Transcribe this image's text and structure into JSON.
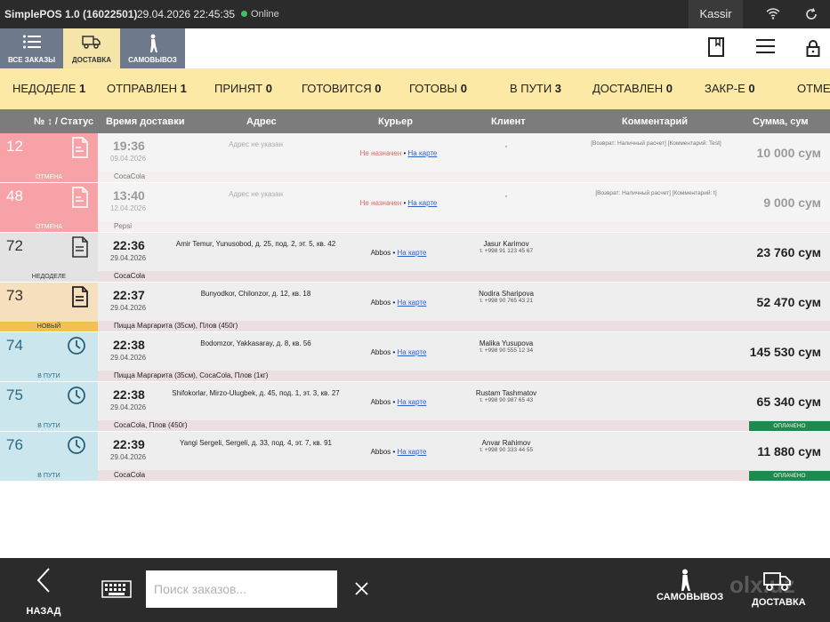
{
  "topbar": {
    "app_title": "SimplePOS 1.0 (16022501)",
    "datetime": "29.04.2026 22:45:35",
    "online": "Online",
    "user": "Kassir"
  },
  "tabs": [
    {
      "label": "ВСЕ ЗАКАЗЫ"
    },
    {
      "label": "ДОСТАВКА"
    },
    {
      "label": "САМОВЫВОЗ"
    }
  ],
  "status_filters": [
    {
      "label": "НЕДОДЕЛЕ",
      "count": "1"
    },
    {
      "label": "ОТПРАВЛЕН",
      "count": "1"
    },
    {
      "label": "ПРИНЯТ",
      "count": "0"
    },
    {
      "label": "ГОТОВИТСЯ",
      "count": "0"
    },
    {
      "label": "ГОТОВЫ",
      "count": "0"
    },
    {
      "label": "В ПУТИ",
      "count": "3"
    },
    {
      "label": "ДОСТАВЛЕН",
      "count": "0"
    },
    {
      "label": "ЗАКР-Е",
      "count": "0"
    },
    {
      "label": "ОТМЕ",
      "count": ""
    }
  ],
  "columns": [
    "№ ↕ / Статус",
    "Время доставки",
    "Адрес",
    "Курьер",
    "Клиент",
    "Комментарий",
    "Сумма, сум"
  ],
  "orders": [
    {
      "num": "12",
      "status": "ОТМЕНА",
      "time": "19:36",
      "date": "09.04.2026",
      "address": "Адрес не указан",
      "courier": "Не назначен",
      "map": "На карте",
      "client": "",
      "phone": "",
      "comment": "[Возврат: Наличный расчет] [Комментарий: Test]",
      "items": "CocaCola",
      "sum": "10 000 сум",
      "paid": ""
    },
    {
      "num": "48",
      "status": "ОТМЕНА",
      "time": "13:40",
      "date": "12.04.2026",
      "address": "Адрес не указан",
      "courier": "Не назначен",
      "map": "На карте",
      "client": "",
      "phone": "",
      "comment": "[Возврат: Наличный расчет] [Комментарий: t]",
      "items": "Pepsi",
      "sum": "9 000 сум",
      "paid": ""
    },
    {
      "num": "72",
      "status": "НЕДОДЕЛЕ",
      "time": "22:36",
      "date": "29.04.2026",
      "address": "Amir Temur, Yunusobod, д. 25, под. 2, эт. 5, кв. 42",
      "courier": "Abbos",
      "map": "На карте",
      "client": "Jasur Karimov",
      "phone": "т. +998 91 123 45 67",
      "comment": "",
      "items": "CocaCola",
      "sum": "23 760 сум",
      "paid": ""
    },
    {
      "num": "73",
      "status": "НОВЫЙ",
      "time": "22:37",
      "date": "29.04.2026",
      "address": "Bunyodkor, Chilonzor, д. 12, кв. 18",
      "courier": "Abbos",
      "map": "На карте",
      "client": "Nodira Sharipova",
      "phone": "т. +998 90 765 43 21",
      "comment": "",
      "items": "Пицца Маргарита (35см), Плов (450г)",
      "sum": "52 470 сум",
      "paid": ""
    },
    {
      "num": "74",
      "status": "В ПУТИ",
      "time": "22:38",
      "date": "29.04.2026",
      "address": "Bodomzor, Yakkasaray, д. 8, кв. 56",
      "courier": "Abbos",
      "map": "На карте",
      "client": "Malika Yusupova",
      "phone": "т. +998 90 555 12 34",
      "comment": "",
      "items": "Пицца Маргарита (35см), CocaCola, Плов (1кг)",
      "sum": "145 530 сум",
      "paid": ""
    },
    {
      "num": "75",
      "status": "В ПУТИ",
      "time": "22:38",
      "date": "29.04.2026",
      "address": "Shifokorlar, Mirzo-Ulugbek, д. 45, под. 1, эт. 3, кв. 27",
      "courier": "Abbos",
      "map": "На карте",
      "client": "Rustam Tashmatov",
      "phone": "т. +998 90 987 65 43",
      "comment": "",
      "items": "CocaCola, Плов (450г)",
      "sum": "65 340 сум",
      "paid": "ОПЛАЧЕНО"
    },
    {
      "num": "76",
      "status": "В ПУТИ",
      "time": "22:39",
      "date": "29.04.2026",
      "address": "Yangi Sergeli, Sergeli, д. 33, под. 4, эт. 7, кв. 91",
      "courier": "Abbos",
      "map": "На карте",
      "client": "Anvar Rahimov",
      "phone": "т. +998 90 333 44 55",
      "comment": "",
      "items": "CocaCola",
      "sum": "11 880 сум",
      "paid": "ОПЛАЧЕНО"
    }
  ],
  "bottombar": {
    "back": "НАЗАД",
    "search_placeholder": "Поиск заказов...",
    "pickup": "САМОВЫВОЗ",
    "delivery": "ДОСТАВКА",
    "watermark": "olx.uz"
  },
  "colors": {
    "cancel": "#f6a2a6",
    "incomplete": "#e3e3e3",
    "new": "#f6dfbd",
    "new_badge": "#f2c150",
    "in_transit": "#cbe6ec",
    "paid": "#1f8a4d",
    "status_bar": "#fbe9a5"
  }
}
